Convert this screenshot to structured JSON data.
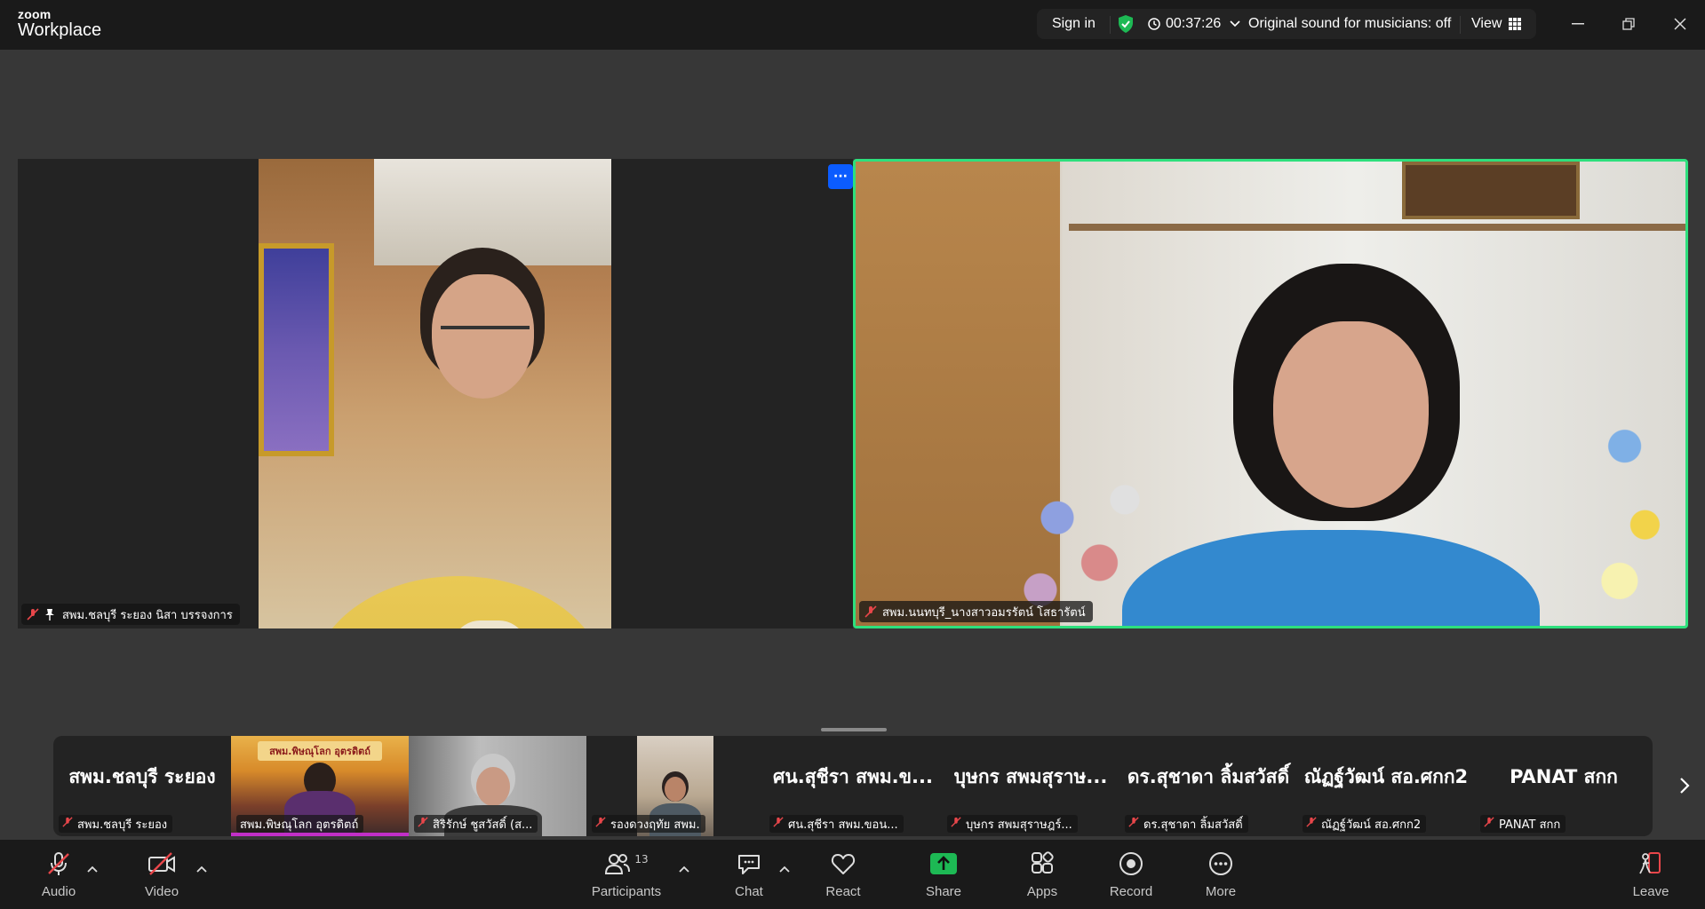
{
  "app": {
    "logo_top": "zoom",
    "logo_bottom": "Workplace"
  },
  "topbar": {
    "sign_in": "Sign in",
    "timer": "00:37:26",
    "original_sound": "Original sound for musicians: off",
    "view": "View",
    "accent_green": "#1db954"
  },
  "stage": {
    "speaker_left": {
      "name": "สพม.ชลบุรี ระยอง นิสา บรรจงการ",
      "muted": true,
      "pinned": true
    },
    "speaker_right": {
      "name": "สพม.นนทบุรี_นางสาวอมรรัตน์ โสธารัตน์",
      "muted": true,
      "active_border_color": "#2ee07d"
    },
    "more_label": "···"
  },
  "filmstrip": {
    "tiles": [
      {
        "big": "สพม.ชลบุรี ระยอง",
        "name": "สพม.ชลบุรี ระยอง",
        "video": false
      },
      {
        "big": "",
        "name": "สพม.พิษณุโลก อุตรดิตถ์",
        "video": true,
        "banner": "สพม.พิษณุโลก อุตรดิตถ์"
      },
      {
        "big": "",
        "name": "สิริรักษ์ ชูสวัสดิ์ (ส...",
        "video": true
      },
      {
        "big": "",
        "name": "รองดวงฤทัย สพม.",
        "video": true
      },
      {
        "big": "ศน.สุชีรา สพม.ข...",
        "name": "ศน.สุชีรา สพม.ขอน...",
        "video": false
      },
      {
        "big": "บุษกร สพมสุราษ...",
        "name": "บุษกร สพมสุราษฎร์...",
        "video": false
      },
      {
        "big": "ดร.สุชาดา ลิ้มสวัสดิ์",
        "name": "ดร.สุชาดา ลิ้มสวัสดิ์",
        "video": false
      },
      {
        "big": "ณัฏฐ์วัฒน์ สอ.ศกก2",
        "name": "ณัฏฐ์วัฒน์ สอ.ศกก2",
        "video": false
      },
      {
        "big": "PANAT สกก",
        "name": "PANAT สกก",
        "video": false
      }
    ]
  },
  "toolbar": {
    "audio": "Audio",
    "video": "Video",
    "participants": "Participants",
    "participants_count": "13",
    "chat": "Chat",
    "react": "React",
    "share": "Share",
    "apps": "Apps",
    "record": "Record",
    "more": "More",
    "leave": "Leave",
    "share_color": "#1db954",
    "mute_color": "#e8464a"
  }
}
